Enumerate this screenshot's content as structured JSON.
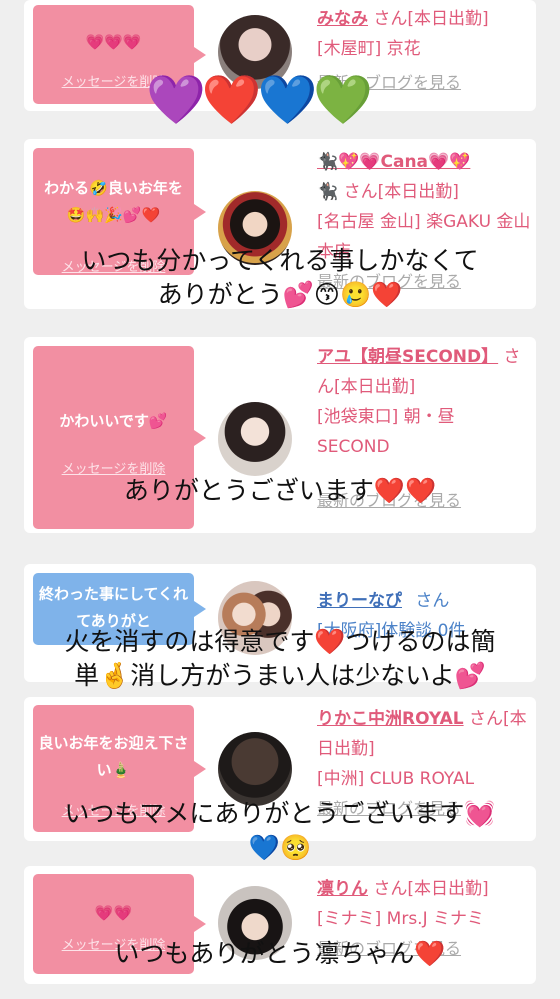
{
  "common": {
    "delete_label": "メッセージを削除",
    "blog_label": "最新のブログを見る"
  },
  "entries": [
    {
      "message": "💗💗💗",
      "name": "みなみ",
      "san": "さん[本日出勤]",
      "place": "[木屋町] 京花"
    },
    {
      "message": "わかる🤣良いお年を🤩🙌🎉💕❤️",
      "name": "🐈‍⬛💖💗Cana💗💖",
      "san": "🐈‍⬛ さん[本日出勤]",
      "place": "[名古屋 金山] 楽GAKU 金山本店"
    },
    {
      "message": "かわいいです💕",
      "name": "アユ【朝昼SECOND】",
      "san": "さん[本日出勤]",
      "place": "[池袋東口] 朝・昼 SECOND"
    },
    {
      "message": "終わった事にしてくれてありがと",
      "name": "まりーなぴ",
      "san": "さん",
      "place": "[大阪府]体験談 0件"
    },
    {
      "message": "良いお年をお迎え下さい🎍",
      "name": "りかこ中洲ROYAL",
      "san": "さん[本日出勤]",
      "place": "[中洲] CLUB ROYAL"
    },
    {
      "message": "💗💗",
      "name": "凛りん",
      "san": "さん[本日出勤]",
      "place": "[ミナミ] Mrs.J ミナミ"
    }
  ],
  "overlays": {
    "hearts": "💜❤️💙💚",
    "o1": "いつも分かってくれる事しかなくて\nありがとう💕😙🥲❤️",
    "o2": "ありがとうございます❤️❤️",
    "o3": "火を消すのは得意です❤️つけるのは簡\n単🤞消し方がうまい人は少ないよ💕",
    "o4": "いつもマメにありがとうございます💓\n💙🥺",
    "o5": "いつもありがとう凛ちゃん❤️"
  }
}
